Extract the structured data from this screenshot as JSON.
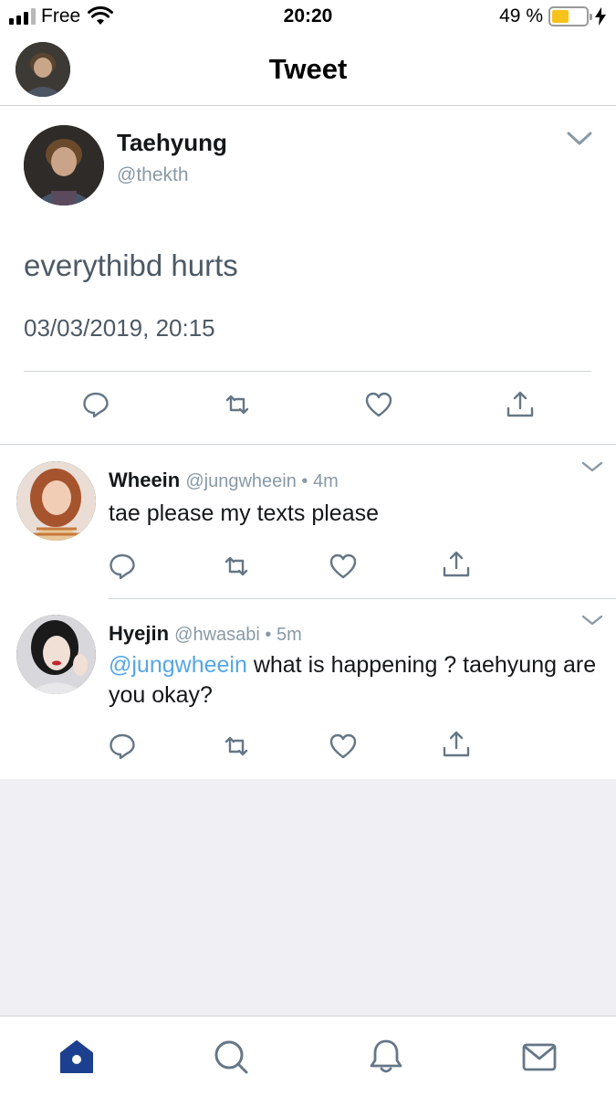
{
  "status_bar": {
    "carrier": "Free",
    "time": "20:20",
    "battery": "49 %",
    "battery_level": 0.49,
    "icons": [
      "signal-icon",
      "wifi-icon",
      "battery-icon",
      "charging-icon"
    ]
  },
  "nav": {
    "title": "Tweet",
    "avatar_icon": "profile-avatar"
  },
  "main_tweet": {
    "name": "Taehyung",
    "handle": "@thekth",
    "text": "everythibd hurts",
    "timestamp": "03/03/2019, 20:15",
    "actions": [
      "reply-icon",
      "retweet-icon",
      "like-icon",
      "share-icon"
    ]
  },
  "replies": [
    {
      "name": "Wheein",
      "meta": "@jungwheein • 4m",
      "text": "tae please my texts please",
      "mention": ""
    },
    {
      "name": "Hyejin",
      "meta": "@hwasabi • 5m",
      "mention": "@jungwheein",
      "text": " what is happening ? taehyung are you okay?"
    }
  ],
  "tab_bar": {
    "items": [
      "home-icon",
      "search-icon",
      "notifications-icon",
      "messages-icon"
    ],
    "active": "home-icon"
  },
  "colors": {
    "accent": "#1d3f8f",
    "mention": "#55a6e8",
    "secondary_text": "#8899a6",
    "battery": "#f7c21a",
    "background_empty": "#efeff4"
  }
}
